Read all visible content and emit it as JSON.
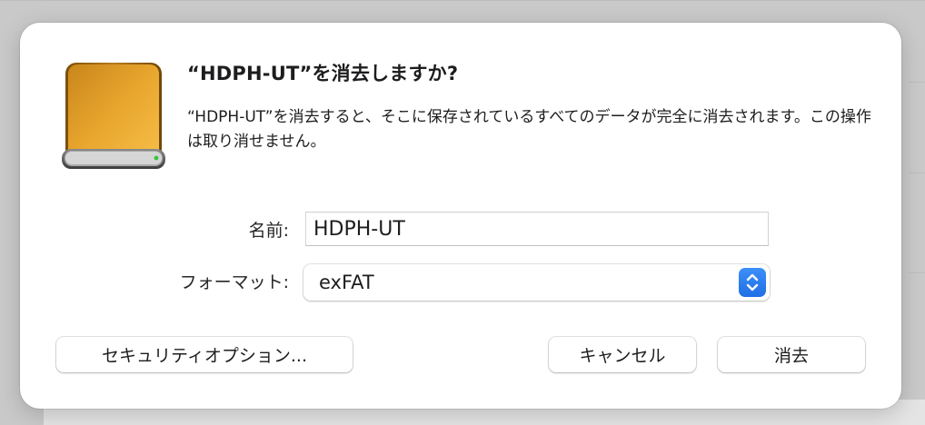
{
  "dialog": {
    "title": "“HDPH-UT”を消去しますか?",
    "message": "“HDPH-UT”を消去すると、そこに保存されているすべてのデータが完全に消去されます。この操作は取り消せません。",
    "drive_icon": "external-drive-icon",
    "name_label": "名前:",
    "name_value": "HDPH-UT",
    "format_label": "フォーマット:",
    "format_value": "exFAT",
    "security_button": "セキュリティオプション...",
    "cancel_button": "キャンセル",
    "erase_button": "消去"
  },
  "colors": {
    "accent": "#1f6fe6",
    "drive_body": "#e3a32b"
  }
}
